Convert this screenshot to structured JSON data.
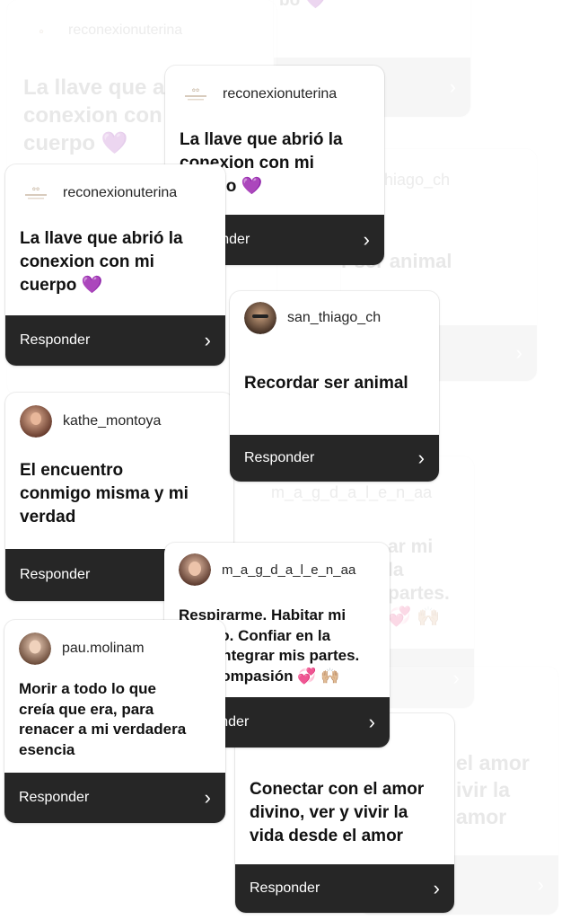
{
  "respond_label": "Responder",
  "colors": {
    "footer": "#262626",
    "heart_purple": "#9b4dde",
    "brand_beige": "#c9b9a6"
  },
  "icons": {
    "chevron": "chevron-right-icon",
    "heart": "purple-heart-emoji",
    "hearts": "sparkling-heart-emoji",
    "hands": "raising-hands-emoji"
  },
  "cards": [
    {
      "id": "ghost-reconexion",
      "user": "reconexionuterina",
      "text": "La llave que abrió la\nconexion con mi\ncuerpo 💜"
    },
    {
      "id": "ghost-thiago",
      "user": "san_thiago_ch",
      "text": "Recordar ser animal"
    },
    {
      "id": "ghost-magdalena",
      "user": "m_a_g_d_a_l_e_n_aa",
      "text": "Respirarme. Habitar mi\ncuerpo. Confiar en la\nvida. Integrar mis partes.\nCon compasión 💞 🙌🏼"
    },
    {
      "id": "ghost-conectar",
      "user": "",
      "text": "Conectar con el amor\ndivino, ver y vivir la\nvida desde el amor"
    },
    {
      "id": "reconexion-2",
      "user": "reconexionuterina",
      "text": "La llave que abrió la\nconexion con mi\ncuerpo 💜"
    },
    {
      "id": "reconexion-1",
      "user": "reconexionuterina",
      "text": "La llave que abrió la\nconexion con mi\ncuerpo 💜"
    },
    {
      "id": "thiago",
      "user": "san_thiago_ch",
      "text": "Recordar ser animal"
    },
    {
      "id": "kathe",
      "user": "kathe_montoya",
      "text": "El encuentro\nconmigo misma y mi\nverdad"
    },
    {
      "id": "magdalena",
      "user": "m_a_g_d_a_l_e_n_aa",
      "text": "Respirarme. Habitar mi\ncuerpo. Confiar en la\nvida. Integrar mis partes.\nCon compasión 💞 🙌🏼"
    },
    {
      "id": "conectar",
      "user": "",
      "text": "Conectar con el amor\ndivino, ver y vivir la\nvida desde el amor"
    },
    {
      "id": "pau",
      "user": "pau.molinam",
      "text": "Morir a todo lo que\ncreía que era, para\nrenacer a mi verdadera\nesencia"
    }
  ]
}
